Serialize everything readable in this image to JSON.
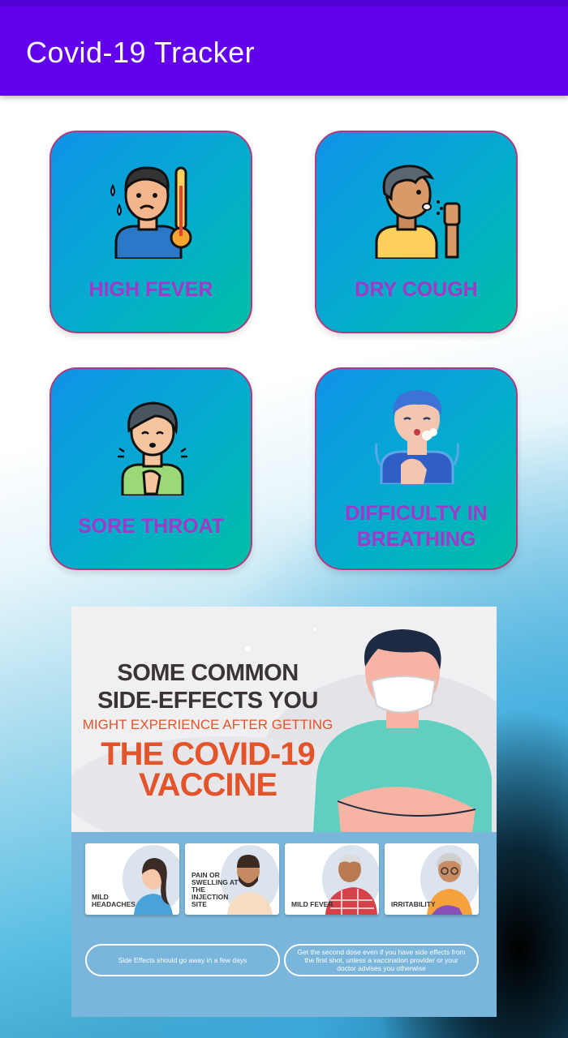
{
  "app": {
    "title": "Covid-19 Tracker"
  },
  "symptoms": [
    {
      "label": "HIGH FEVER",
      "icon": "fever-person-thermometer-icon"
    },
    {
      "label": "DRY COUGH",
      "icon": "coughing-person-icon"
    },
    {
      "label": "SORE THROAT",
      "icon": "sore-throat-person-icon"
    },
    {
      "label": "DIFFICULTY IN BREATHING",
      "line1": "DIFFICULTY IN",
      "line2": "BREATHING",
      "icon": "breathing-difficulty-person-icon"
    }
  ],
  "poster": {
    "line1": "SOME COMMON",
    "line2": "SIDE-EFFECTS YOU",
    "line3": "MIGHT EXPERIENCE AFTER GETTING",
    "line4": "THE COVID-19",
    "line5": "VACCINE",
    "side_effects": [
      {
        "label": "MILD HEADACHES"
      },
      {
        "label": "PAIN OR SWELLING AT THE INJECTION SITE"
      },
      {
        "label": "MILD FEVER"
      },
      {
        "label": "IRRITABILITY"
      }
    ],
    "note_left": "Side Effects should go away in a few days",
    "note_right": "Get the second dose even if you have side effects from the first shot, unless a vaccination provider or your doctor advises you otherwise"
  },
  "colors": {
    "app_bar": "#6200ee",
    "status_bar": "#5200d6",
    "card_label": "#a238c9",
    "card_border": "#b03a7e",
    "poster_accent": "#e4542a"
  }
}
